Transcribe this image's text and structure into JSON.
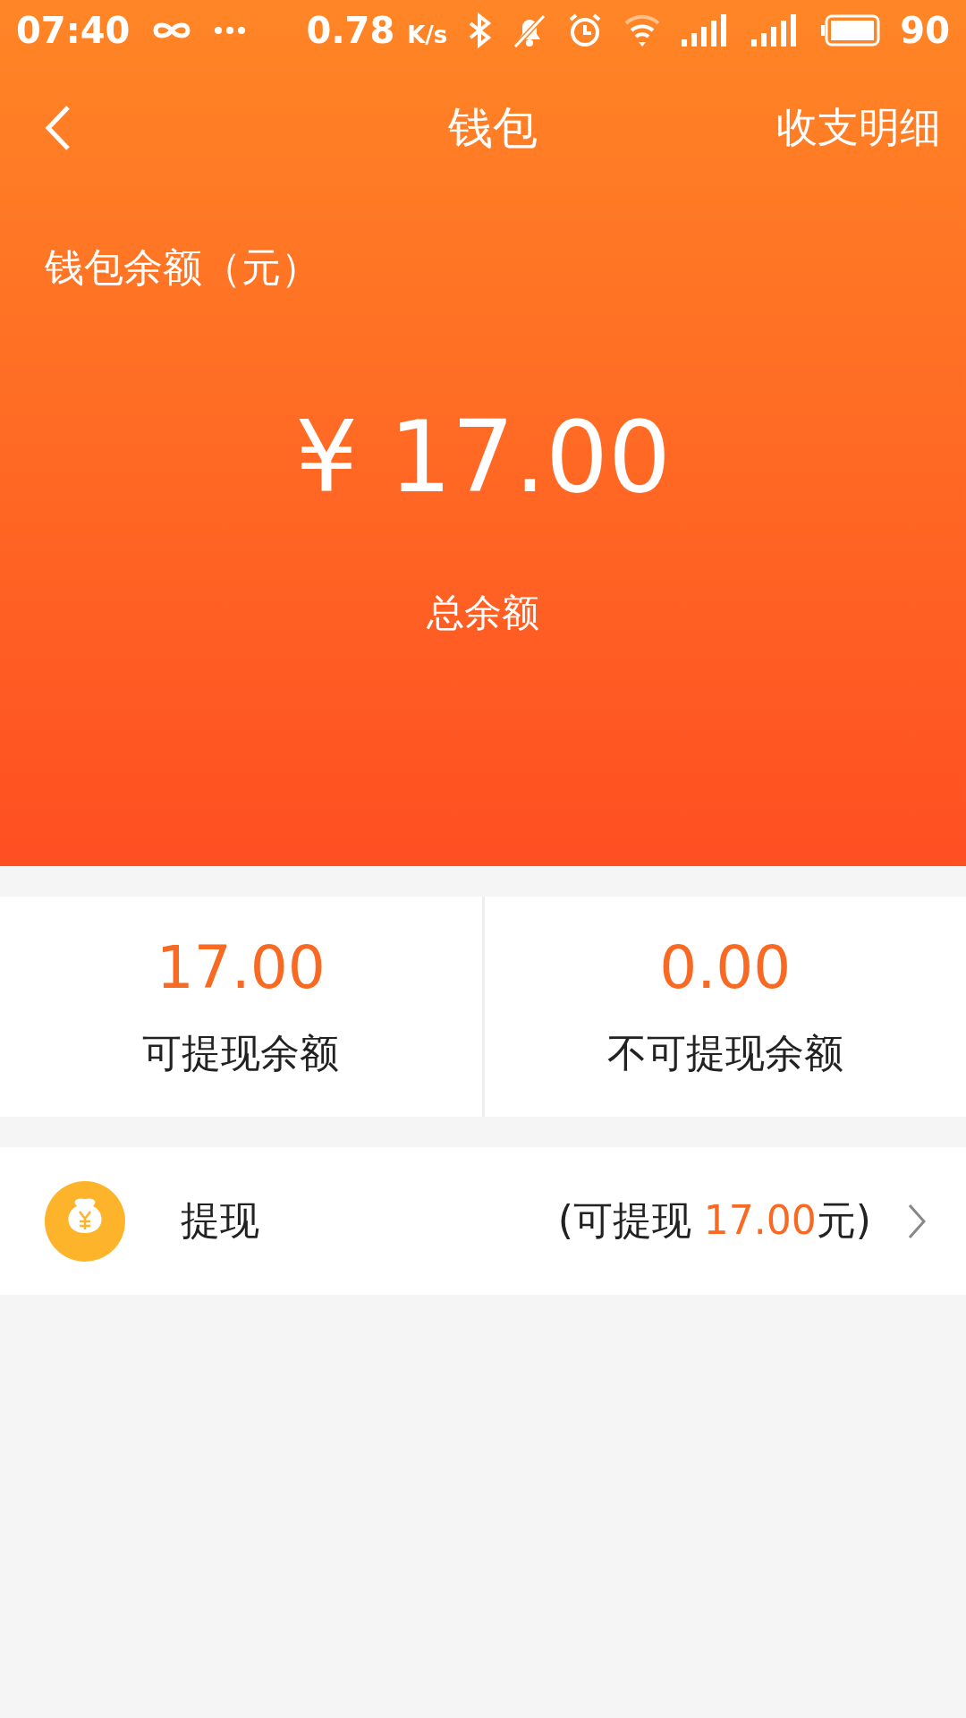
{
  "status_bar": {
    "time": "07:40",
    "speed": "0.78",
    "speed_unit": "K/s",
    "battery": "90"
  },
  "nav": {
    "title": "钱包",
    "action": "收支明细"
  },
  "balance": {
    "label": "钱包余额（元）",
    "amount": "¥ 17.00",
    "caption": "总余额"
  },
  "stats": [
    {
      "value": "17.00",
      "label": "可提现余额"
    },
    {
      "value": "0.00",
      "label": "不可提现余额"
    }
  ],
  "withdraw": {
    "label": "提现",
    "available_prefix": "(可提现 ",
    "available_amount": "17.00",
    "available_suffix": "元)"
  }
}
